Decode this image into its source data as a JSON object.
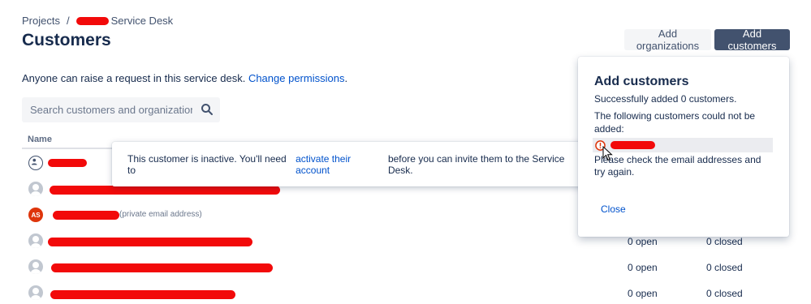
{
  "breadcrumb": {
    "projects": "Projects",
    "separator": "/",
    "project": "Service Desk"
  },
  "page_title": "Customers",
  "buttons": {
    "add_organizations": "Add organizations",
    "add_customers": "Add customers"
  },
  "info": {
    "text": "Anyone can raise a request in this service desk.",
    "link": "Change permissions",
    "suffix": "."
  },
  "search": {
    "placeholder": "Search customers and organizations"
  },
  "table": {
    "name_header": "Name",
    "rows": [
      {
        "avatar": "org",
        "private_note": "",
        "open": "",
        "closed": ""
      },
      {
        "avatar": "user",
        "private_note": "",
        "open": "",
        "closed": ""
      },
      {
        "avatar": "initials",
        "initials": "AS",
        "private_note": "(private email address)",
        "open": "",
        "closed": ""
      },
      {
        "avatar": "user",
        "private_note": "",
        "open": "0 open",
        "closed": "0 closed"
      },
      {
        "avatar": "user",
        "private_note": "",
        "open": "0 open",
        "closed": "0 closed"
      },
      {
        "avatar": "user",
        "private_note": "",
        "open": "0 open",
        "closed": "0 closed"
      }
    ]
  },
  "tooltip": {
    "prefix": "This customer is inactive. You'll need to",
    "link": "activate their account",
    "suffix": "before you can invite them to the Service Desk."
  },
  "dialog": {
    "title": "Add customers",
    "success": "Successfully added 0 customers.",
    "failed": "The following customers could not be added:",
    "help": "Please check the email addresses and try again.",
    "close": "Close"
  },
  "colors": {
    "primary_button": "#42526e",
    "link": "#0052cc",
    "error": "#de350b",
    "redaction": "#f20a0a"
  }
}
